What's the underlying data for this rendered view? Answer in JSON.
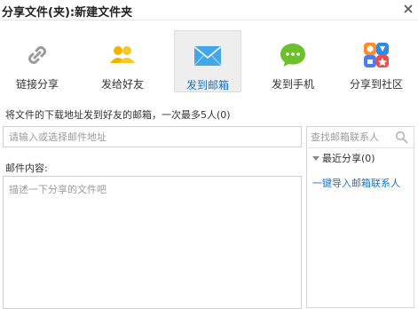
{
  "dialog": {
    "title": "分享文件(夹):新建文件夹"
  },
  "tabs": [
    {
      "label": "链接分享",
      "icon": "link-icon",
      "active": false
    },
    {
      "label": "发给好友",
      "icon": "friends-icon",
      "active": false
    },
    {
      "label": "发到邮箱",
      "icon": "mail-icon",
      "active": true
    },
    {
      "label": "发到手机",
      "icon": "chat-bubble-icon",
      "active": false
    },
    {
      "label": "分享到社区",
      "icon": "community-icon",
      "active": false
    }
  ],
  "email_form": {
    "hint": "将文件的下载地址发到好友的邮箱，一次最多5人(0)",
    "recipient_placeholder": "请输入或选择邮件地址",
    "content_label": "邮件内容:",
    "content_placeholder": "描述一下分享的文件吧"
  },
  "contacts": {
    "search_placeholder": "查找邮箱联系人",
    "recent_label": "最近分享(0)",
    "import_link": "一键导入邮箱联系人"
  },
  "colors": {
    "accent": "#1a73c8",
    "border": "#cfcfcf",
    "active_tab_bg": "#eeeeee"
  }
}
